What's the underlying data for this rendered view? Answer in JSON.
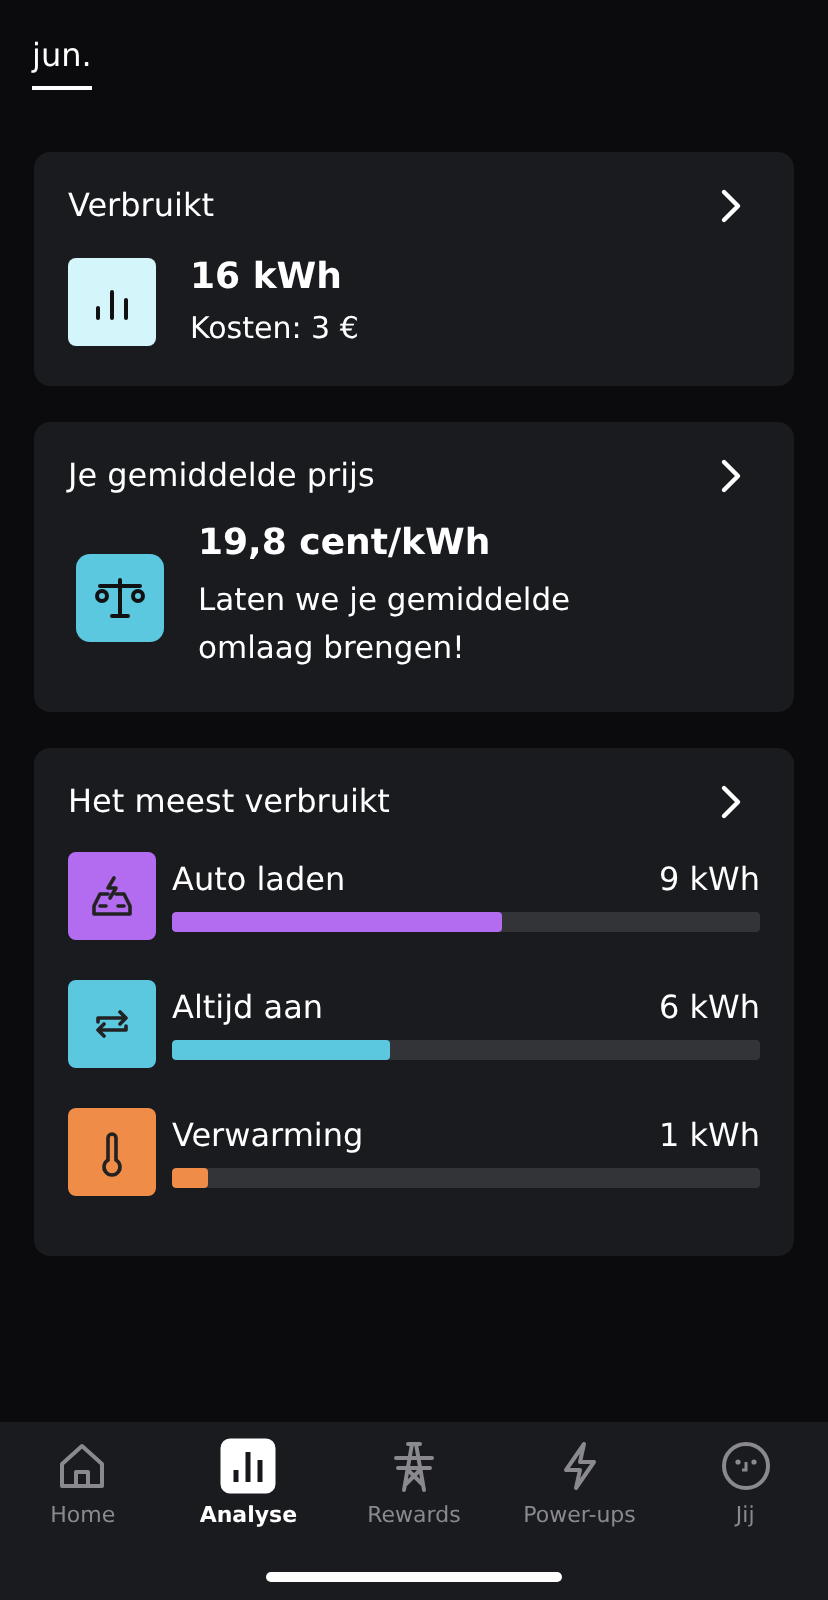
{
  "period_tabs": [
    {
      "label": "jun.",
      "selected": true
    }
  ],
  "usage_card": {
    "title": "Verbruikt",
    "value": "16 kWh",
    "cost": "Kosten: 3 €"
  },
  "price_card": {
    "title": "Je gemiddelde prijs",
    "value": "19,8 cent/kWh",
    "message": "Laten we je gemiddelde omlaag brengen!"
  },
  "top_usage": {
    "title": "Het meest verbruikt",
    "items": [
      {
        "kind": "car",
        "label": "Auto laden",
        "reading": "9 kWh",
        "level": 0.56,
        "color": "#b36cf0"
      },
      {
        "kind": "repeat",
        "label": "Altijd aan",
        "reading": "6 kWh",
        "level": 0.37,
        "color": "#5bc8e0"
      },
      {
        "kind": "thermometer",
        "label": "Verwarming",
        "reading": "1 kWh",
        "level": 0.06,
        "color": "#ee8c48"
      }
    ]
  },
  "tab_bar": [
    {
      "kind": "home",
      "label": "Home",
      "selected": false
    },
    {
      "kind": "analyse",
      "label": "Analyse",
      "selected": true
    },
    {
      "kind": "pylon",
      "label": "Rewards",
      "selected": false
    },
    {
      "kind": "bolt",
      "label": "Power-ups",
      "selected": false
    },
    {
      "kind": "face",
      "label": "Jij",
      "selected": false
    }
  ]
}
